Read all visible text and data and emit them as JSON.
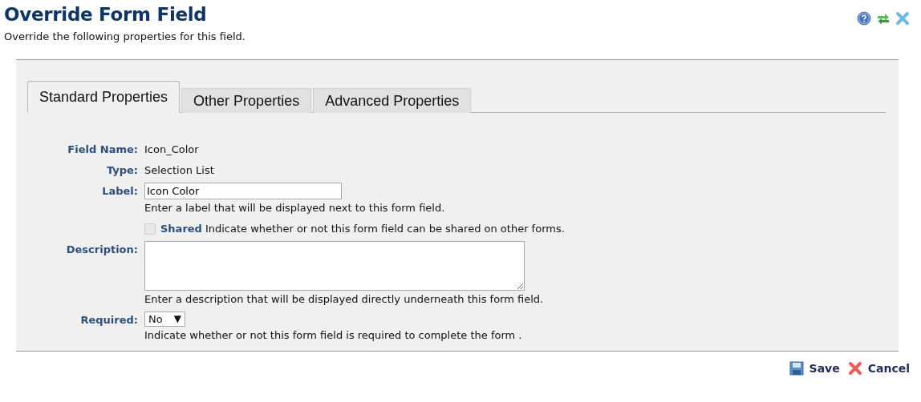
{
  "header": {
    "title": "Override Form Field",
    "subtitle": "Override the following properties for this field."
  },
  "tabs": [
    {
      "label": "Standard Properties",
      "selected": true
    },
    {
      "label": "Other Properties",
      "selected": false
    },
    {
      "label": "Advanced Properties",
      "selected": false
    }
  ],
  "fields": [
    {
      "kind": "text",
      "label": "Field Name:",
      "value": "Icon_Color"
    },
    {
      "kind": "text",
      "label": "Type:",
      "value": "Selection List"
    },
    {
      "kind": "input",
      "label": "Label:",
      "value": "Icon Color",
      "hint": "Enter a label that will be displayed next to this form field."
    },
    {
      "kind": "checkbox",
      "label": "Shared",
      "description": "Indicate whether or not this form field can be shared on other forms.",
      "checked": false,
      "disabled": true
    },
    {
      "kind": "textarea",
      "label": "Description:",
      "hint": "Enter a description that will be displayed directly underneath this form field."
    },
    {
      "kind": "select",
      "label": "Required:",
      "value": "No",
      "caret": "▼",
      "hint": "Indicate whether or not this form field is required to complete the form ."
    }
  ],
  "actions": [
    {
      "kind": "save",
      "label": "Save"
    },
    {
      "kind": "cancel",
      "label": "Cancel"
    }
  ]
}
